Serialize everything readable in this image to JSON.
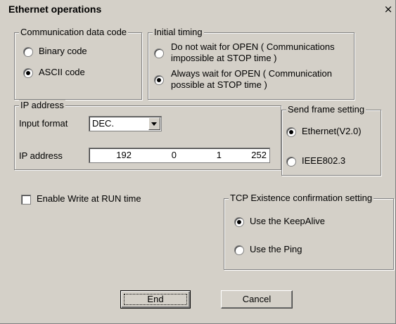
{
  "window": {
    "title": "Ethernet operations",
    "close_glyph": "×"
  },
  "comm_code": {
    "legend": "Communication data code",
    "options": [
      {
        "label": "Binary code",
        "checked": false
      },
      {
        "label": "ASCII code",
        "checked": true
      }
    ]
  },
  "initial_timing": {
    "legend": "Initial timing",
    "options": [
      {
        "line1": "Do not wait for OPEN ( Communications",
        "line2": "impossible at STOP time )",
        "checked": false
      },
      {
        "line1": "Always wait for OPEN ( Communication",
        "line2": "possible at STOP time )",
        "checked": true
      }
    ]
  },
  "ip_address": {
    "legend": "IP address",
    "input_format_label": "Input format",
    "input_format_value": "DEC.",
    "address_label": "IP address",
    "octets": [
      "192",
      "0",
      "1",
      "252"
    ]
  },
  "send_frame": {
    "legend": "Send frame setting",
    "options": [
      {
        "label": "Ethernet(V2.0)",
        "checked": true
      },
      {
        "label": "IEEE802.3",
        "checked": false
      }
    ]
  },
  "enable_write": {
    "label": "Enable Write at RUN time",
    "checked": false
  },
  "tcp": {
    "legend": "TCP Existence confirmation setting",
    "options": [
      {
        "label": "Use the KeepAlive",
        "checked": true
      },
      {
        "label": "Use the Ping",
        "checked": false
      }
    ]
  },
  "buttons": {
    "end": "End",
    "cancel": "Cancel"
  }
}
